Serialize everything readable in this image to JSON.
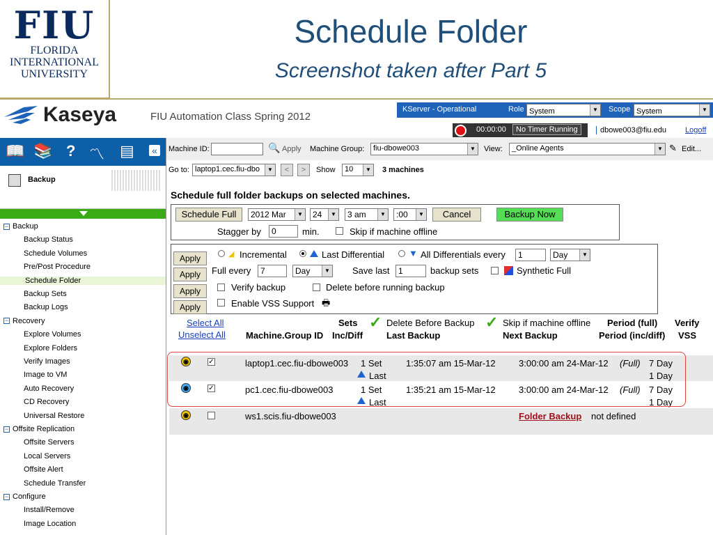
{
  "slide": {
    "logo_big": "FIU",
    "logo_lines": [
      "FLORIDA",
      "INTERNATIONAL",
      "UNIVERSITY"
    ],
    "title": "Schedule Folder",
    "subtitle": "Screenshot taken after Part 5"
  },
  "header": {
    "brand": "Kaseya",
    "app_title": "FIU Automation Class Spring 2012",
    "kserver": "KServer - Operational",
    "role_label": "Role",
    "role_value": "System",
    "scope_label": "Scope",
    "scope_value": "System",
    "timer": "00:00:00",
    "timer_status": "No Timer Running",
    "user": "dbowe003@fiu.edu",
    "logoff": "Logoff"
  },
  "toolbar": {
    "machine_id_label": "Machine ID:",
    "apply": "Apply",
    "machine_group_label": "Machine Group:",
    "machine_group_value": "fiu-dbowe003",
    "view_label": "View:",
    "view_value": "_Online Agents",
    "edit": "Edit..."
  },
  "gotobar": {
    "goto_label": "Go to:",
    "goto_value": "laptop1.cec.fiu-dbo",
    "prev": "<",
    "next": ">",
    "show_label": "Show",
    "show_value": "10",
    "machine_count": "3 machines"
  },
  "nav": {
    "module": "Backup",
    "tree": [
      {
        "label": "Backup",
        "level": 0
      },
      {
        "label": "Backup Status",
        "level": 1
      },
      {
        "label": "Schedule Volumes",
        "level": 1
      },
      {
        "label": "Pre/Post Procedure",
        "level": 1
      },
      {
        "label": "Schedule Folder",
        "level": 1,
        "selected": true
      },
      {
        "label": "Backup Sets",
        "level": 1
      },
      {
        "label": "Backup Logs",
        "level": 1
      },
      {
        "label": "Recovery",
        "level": 0
      },
      {
        "label": "Explore Volumes",
        "level": 1
      },
      {
        "label": "Explore Folders",
        "level": 1
      },
      {
        "label": "Verify Images",
        "level": 1
      },
      {
        "label": "Image to VM",
        "level": 1
      },
      {
        "label": "Auto Recovery",
        "level": 1
      },
      {
        "label": "CD Recovery",
        "level": 1
      },
      {
        "label": "Universal Restore",
        "level": 1
      },
      {
        "label": "Offsite Replication",
        "level": 0
      },
      {
        "label": "Offsite Servers",
        "level": 1
      },
      {
        "label": "Local Servers",
        "level": 1
      },
      {
        "label": "Offsite Alert",
        "level": 1
      },
      {
        "label": "Schedule Transfer",
        "level": 1
      },
      {
        "label": "Configure",
        "level": 0
      },
      {
        "label": "Install/Remove",
        "level": 1
      },
      {
        "label": "Image Location",
        "level": 1
      }
    ]
  },
  "content": {
    "heading": "Schedule full folder backups on selected machines.",
    "schedule_full": "Schedule Full",
    "date_month": "2012 Mar",
    "date_day": "24",
    "time_hour": "3 am",
    "time_min": ":00",
    "cancel": "Cancel",
    "backup_now": "Backup Now",
    "stagger_label": "Stagger by",
    "stagger_value": "0",
    "min_label": "min.",
    "skip_offline": "Skip if machine offline",
    "apply": "Apply",
    "incremental": "Incremental",
    "last_differential": "Last Differential",
    "all_diff_every": "All Differentials every",
    "diff_every_value": "1",
    "day": "Day",
    "full_every": "Full every",
    "full_every_value": "7",
    "save_last": "Save last",
    "save_last_value": "1",
    "backup_sets": "backup sets",
    "synthetic_full": "Synthetic Full",
    "verify_backup": "Verify backup",
    "delete_before": "Delete before running backup",
    "enable_vss": "Enable VSS Support"
  },
  "table": {
    "select_all": "Select All",
    "unselect_all": "Unselect All",
    "col_machine": "Machine.Group ID",
    "col_sets": "Sets",
    "col_inc_diff": "Inc/Diff",
    "col_delete_before": "Delete Before Backup",
    "col_last_backup": "Last Backup",
    "col_skip": "Skip if machine offline",
    "col_next_backup": "Next Backup",
    "col_period_full": "Period (full)",
    "col_period_inc": "Period (inc/diff)",
    "col_verify": "Verify",
    "col_vss": "VSS",
    "rows": [
      {
        "machine": "laptop1.cec.fiu-dbowe003",
        "sets": "1 Set",
        "inc": "Last",
        "last_backup": "1:35:07 am 15-Mar-12",
        "next_backup": "3:00:00 am 24-Mar-12",
        "full_tag": "(Full)",
        "period_full": "7 Day",
        "period_inc": "1 Day"
      },
      {
        "machine": "pc1.cec.fiu-dbowe003",
        "sets": "1 Set",
        "inc": "Last",
        "last_backup": "1:35:21 am 15-Mar-12",
        "next_backup": "3:00:00 am 24-Mar-12",
        "full_tag": "(Full)",
        "period_full": "7 Day",
        "period_inc": "1 Day"
      },
      {
        "machine": "ws1.scis.fiu-dbowe003",
        "folder_backup": "Folder Backup",
        "not_defined": "not defined"
      }
    ]
  },
  "colors": {
    "nav_blue": "#0d5fa8",
    "green": "#3aaa17",
    "title_blue": "#1f4e79",
    "fiu_navy": "#0a2a5e",
    "highlight_red": "#e04040"
  }
}
